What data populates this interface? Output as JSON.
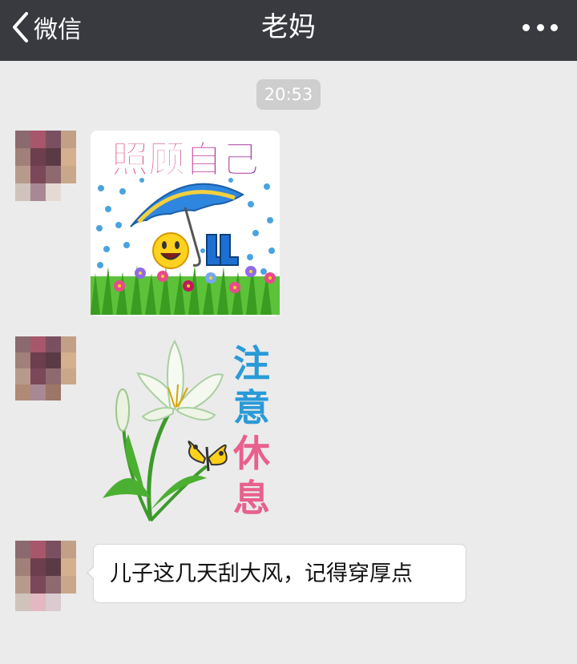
{
  "navbar": {
    "back_label": "微信",
    "title": "老妈",
    "more_icon": "more-dots-icon",
    "background": "#393a3f"
  },
  "chat": {
    "timestamp": "20:53",
    "messages": [
      {
        "type": "sticker",
        "sender": "contact",
        "text": "照顾自己",
        "icons": [
          "umbrella-icon",
          "smiley-icon",
          "rain-boots-icon",
          "flowers-icon"
        ]
      },
      {
        "type": "sticker",
        "sender": "contact",
        "text_lines": [
          "注",
          "意",
          "休",
          "息"
        ],
        "icons": [
          "lily-flower-icon",
          "butterfly-icon"
        ]
      },
      {
        "type": "text",
        "sender": "contact",
        "text": "儿子这几天刮大风，记得穿厚点"
      }
    ]
  },
  "colors": {
    "chat_background": "#ebebeb",
    "bubble_background": "#ffffff",
    "timestamp_background": "#cececf",
    "sticker1_text": "#c2185b",
    "sticker2_blue": "#2a9ad8",
    "sticker2_pink": "#e8608d"
  }
}
